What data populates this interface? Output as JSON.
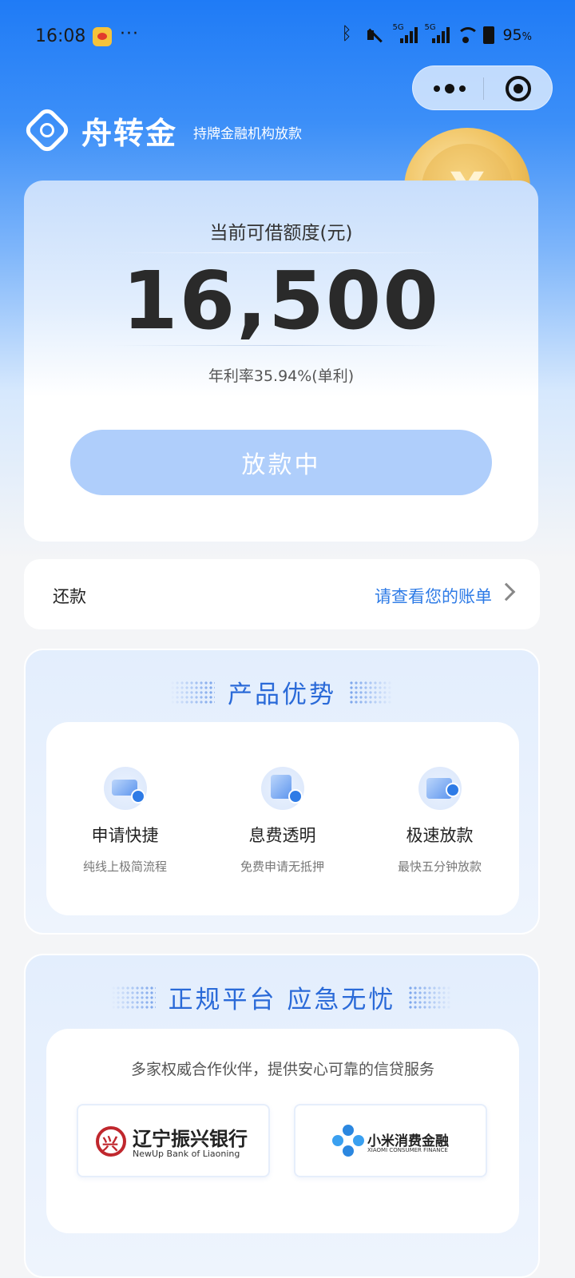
{
  "status_bar": {
    "time": "16:08",
    "dots": "···",
    "network_1": "5G",
    "network_2": "5G",
    "battery": "95",
    "battery_unit": "%"
  },
  "brand": {
    "name": "舟转金",
    "tagline": "持牌金融机构放款"
  },
  "coin": {
    "symbol": "¥"
  },
  "credit": {
    "label": "当前可借额度(元)",
    "amount": "16,500",
    "rate": "年利率35.94%(单利)",
    "button_label": "放款中"
  },
  "repay": {
    "label": "还款",
    "link": "请查看您的账单"
  },
  "advantages": {
    "title": "产品优势",
    "items": [
      {
        "title": "申请快捷",
        "desc": "纯线上极简流程",
        "icon": "card-icon"
      },
      {
        "title": "息费透明",
        "desc": "免费申请无抵押",
        "icon": "document-icon"
      },
      {
        "title": "极速放款",
        "desc": "最快五分钟放款",
        "icon": "wallet-icon"
      }
    ]
  },
  "platform": {
    "title": "正规平台 应急无忧",
    "desc": "多家权威合作伙伴，提供安心可靠的信贷服务",
    "partners": [
      {
        "name": "辽宁振兴银行",
        "en": "NewUp Bank of Liaoning"
      },
      {
        "name": "小米消费金融",
        "en": "XIAOMI CONSUMER FINANCE"
      }
    ]
  },
  "colors": {
    "primary": "#2e7be6",
    "header_blue": "#1f7bf6",
    "button_disabled": "#afcefb",
    "bank_red": "#c0272d"
  }
}
